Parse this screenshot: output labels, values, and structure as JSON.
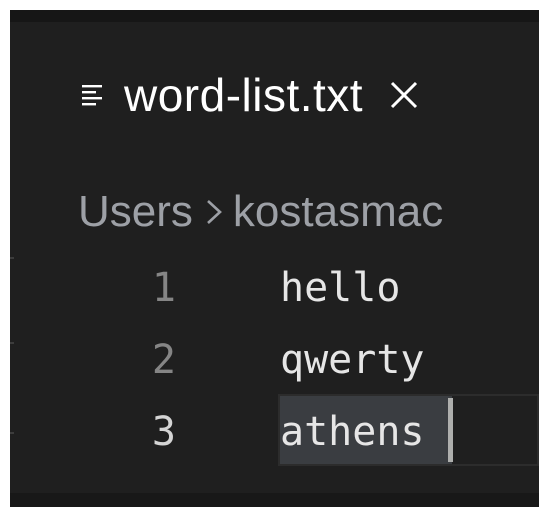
{
  "tab": {
    "icon": "lines-file-icon",
    "title": "word-list.txt",
    "close_icon": "close-icon"
  },
  "breadcrumb": {
    "items": [
      "Users",
      "kostasmac"
    ],
    "separator_icon": "chevron-right-icon"
  },
  "editor": {
    "lines": [
      {
        "number": "1",
        "text": "hello"
      },
      {
        "number": "2",
        "text": "qwerty"
      },
      {
        "number": "3",
        "text": "athens"
      }
    ],
    "active_line": "3"
  },
  "colors": {
    "background": "#1f1f1f",
    "text": "#e6e6e6",
    "line_number": "#858585",
    "selection": "#3a3d41",
    "breadcrumb": "#9da0a6"
  }
}
